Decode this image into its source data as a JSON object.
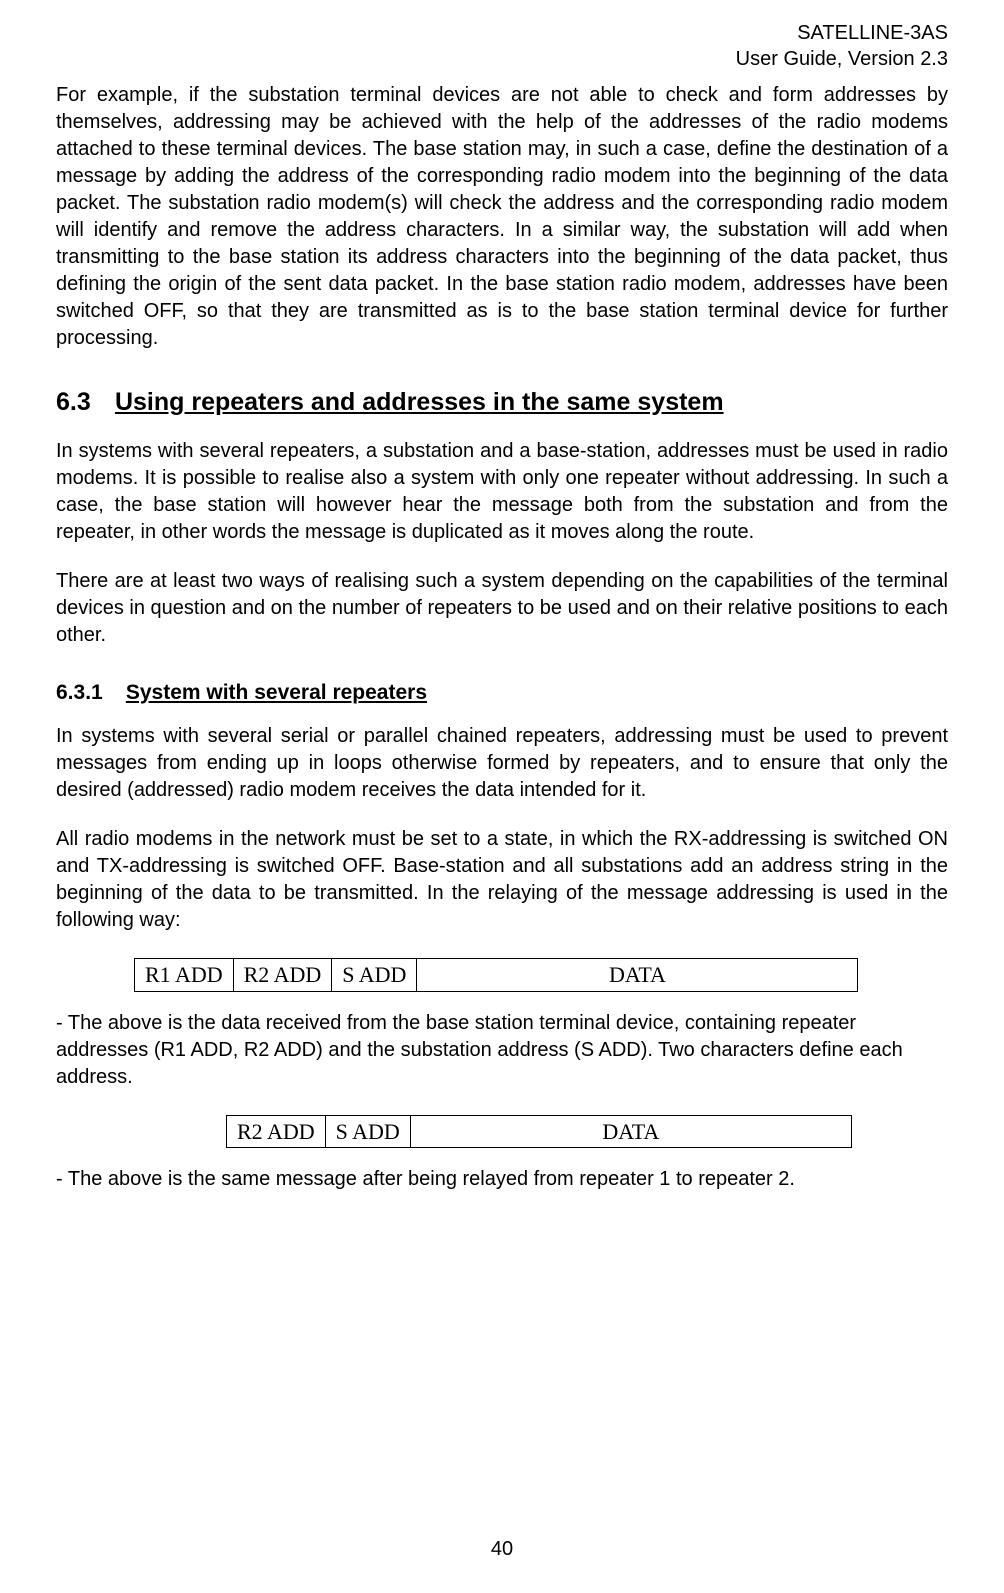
{
  "header": {
    "line1": "SATELLINE-3AS",
    "line2": "User Guide, Version 2.3"
  },
  "para1": "For example, if the substation terminal devices are not able to check and form addresses by themselves, addressing may be achieved with the help of the addresses of the radio modems attached to these terminal devices. The base station may, in such a case, define the destination of a message by adding the address of the corresponding radio modem into the beginning of the data packet. The substation radio modem(s) will check the address and the corresponding radio modem will identify and remove the address characters. In a similar way, the substation will add when transmitting to the base station its address characters into the beginning of the data packet, thus defining the origin of the sent data packet. In the base station radio modem, addresses have been switched OFF, so that they are transmitted as is to the base station terminal device for further processing.",
  "section63": {
    "num": "6.3",
    "title": "Using repeaters and addresses in the same system"
  },
  "para2": "In systems with several repeaters, a substation and a base-station, addresses must be used in radio modems. It is possible to realise also a system with only one repeater without addressing. In such a case, the base station will however hear the message both from the substation and from the repeater, in other words the message is duplicated as it moves along the route.",
  "para3": "There are at least two ways of realising such a system depending on the capabilities of the terminal devices in question and on the number of repeaters to be used and on their relative positions to each other.",
  "section631": {
    "num": "6.3.1",
    "title": "System with several repeaters"
  },
  "para4": "In systems with several serial or parallel chained repeaters, addressing must be used to prevent messages from ending up in loops otherwise formed by repeaters, and to ensure that only the desired (addressed) radio modem receives the data intended for it.",
  "para5": "All radio modems in the network must be set to a state, in which the RX-addressing is switched ON and TX-addressing is switched OFF. Base-station and all substations add an address string in the beginning of the data to be transmitted. In the relaying of the message addressing is used in the following way:",
  "table1": {
    "c1": "R1 ADD",
    "c2": "R2 ADD",
    "c3": "S ADD",
    "c4": "DATA"
  },
  "para6": "- The above is the data received from the base station terminal device, containing repeater addresses (R1 ADD, R2 ADD) and the substation address (S ADD). Two characters define each address.",
  "table2": {
    "c1": "R2 ADD",
    "c2": "S ADD",
    "c3": "DATA"
  },
  "para7": "- The above is the same message after being relayed from repeater 1 to repeater 2.",
  "pagenum": "40"
}
